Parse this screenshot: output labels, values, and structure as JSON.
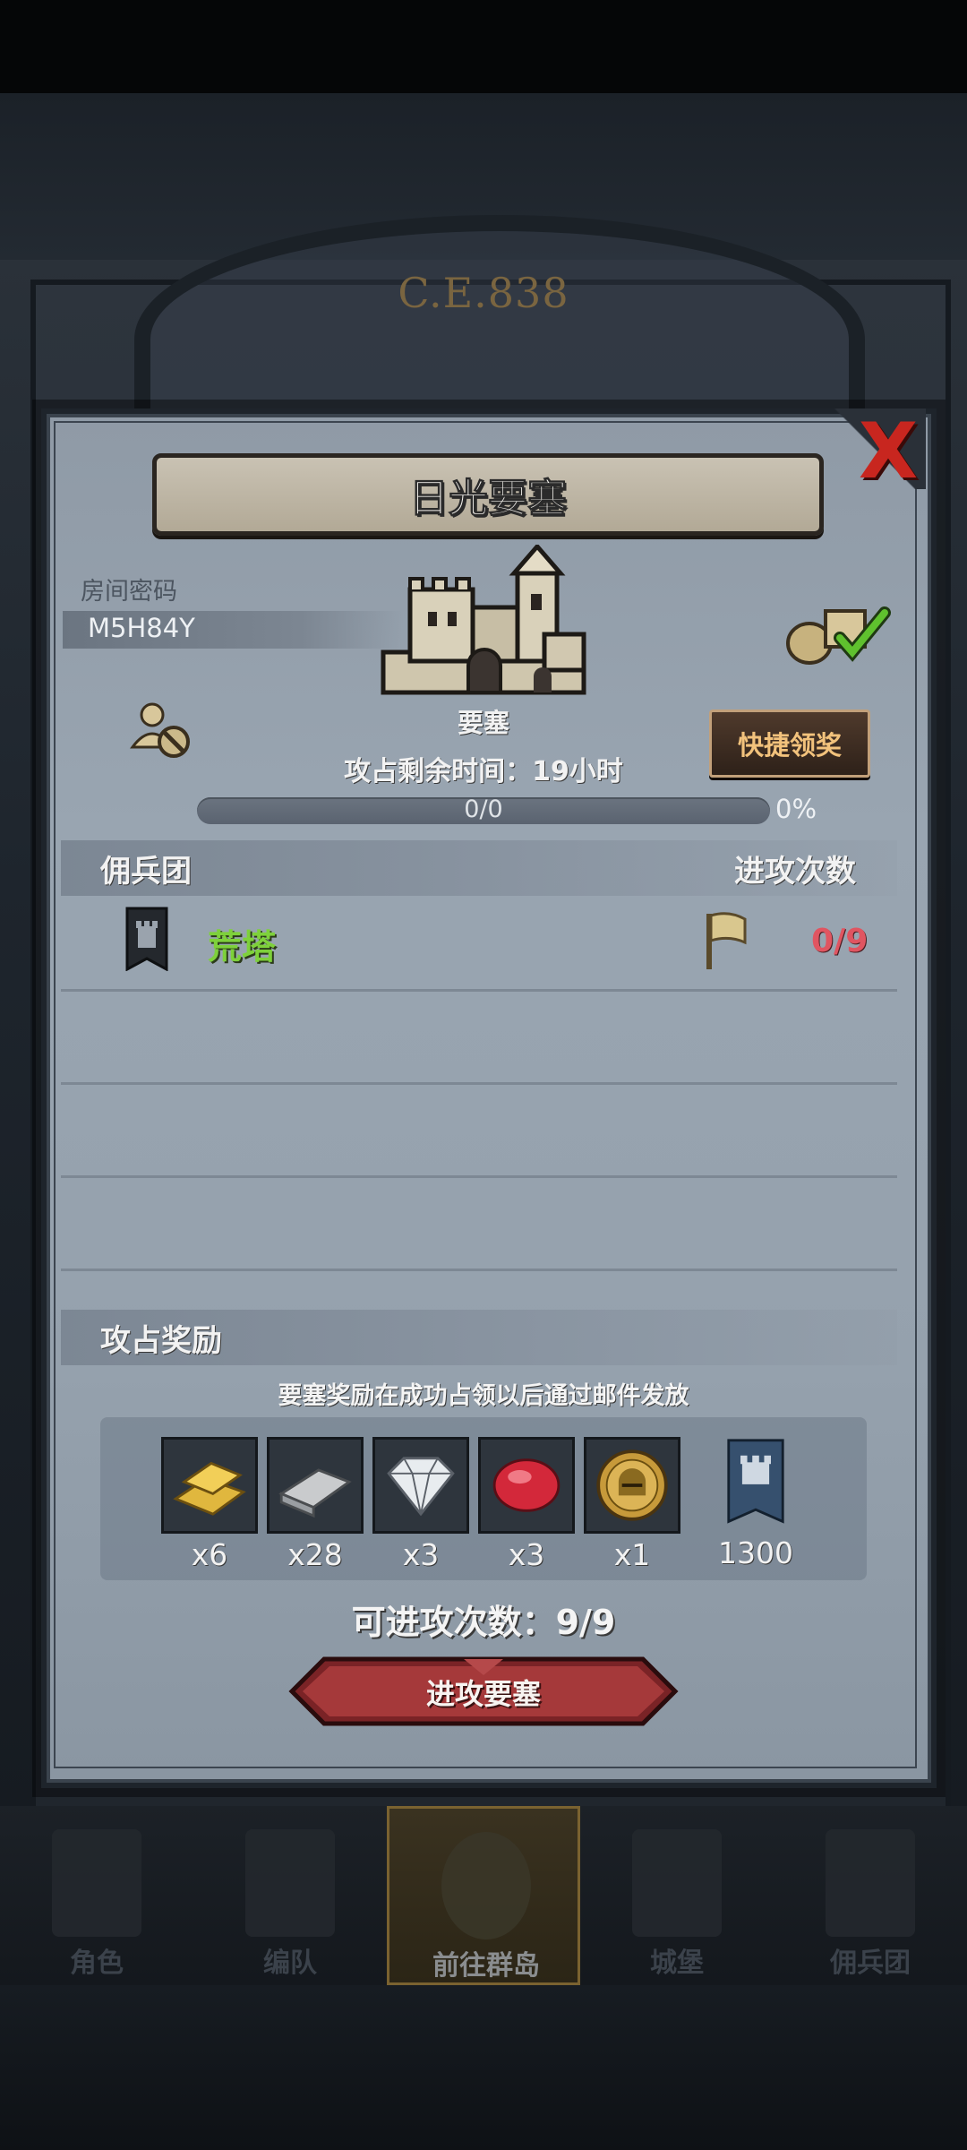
{
  "background": {
    "era_label": "C.E.838"
  },
  "dialog": {
    "title": "日光要塞",
    "room": {
      "label": "房间密码",
      "code": "M5H84Y"
    },
    "building_label": "要塞",
    "quick_claim_label": "快捷领奖",
    "time_remaining": "攻占剩余时间：19小时",
    "progress": {
      "text": "0/0",
      "percent": "0%",
      "fraction": 0
    },
    "legion_section": {
      "title": "佣兵团",
      "attack_header": "进攻次数"
    },
    "legion_rows": [
      {
        "name": "荒塔",
        "attacks": "0/9"
      }
    ],
    "reward_section": {
      "title": "攻占奖励",
      "note": "要塞奖励在成功占领以后通过邮件发放",
      "items": [
        {
          "icon": "gold-bar-icon",
          "qty": "x6"
        },
        {
          "icon": "iron-bar-icon",
          "qty": "x28"
        },
        {
          "icon": "diamond-icon",
          "qty": "x3"
        },
        {
          "icon": "ruby-icon",
          "qty": "x3"
        },
        {
          "icon": "helmet-coin-icon",
          "qty": "x1"
        },
        {
          "icon": "guild-banner-icon",
          "qty": "1300"
        }
      ]
    },
    "attacks_left": "可进攻次数：9/9",
    "attack_button_label": "进攻要塞",
    "close_label": "X"
  },
  "nav": [
    {
      "label": "角色",
      "icon": "knight-icon",
      "active": false
    },
    {
      "label": "编队",
      "icon": "helmet-icon",
      "active": false
    },
    {
      "label": "前往群岛",
      "icon": "compass-icon",
      "active": true
    },
    {
      "label": "城堡",
      "icon": "castle-icon",
      "active": false
    },
    {
      "label": "佣兵团",
      "icon": "mercenary-icon",
      "active": false
    }
  ],
  "colors": {
    "accent_green": "#7ed13b",
    "accent_red": "#e05561",
    "close_red": "#c8261f",
    "quick_btn_text": "#f2c27c"
  }
}
